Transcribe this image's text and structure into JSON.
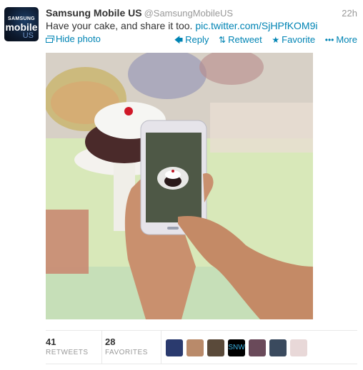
{
  "account": {
    "avatar_lines": [
      "SAMSUNG",
      "mobile",
      "US"
    ],
    "full_name": "Samsung Mobile US",
    "username": "@SamsungMobileUS",
    "timestamp": "22h"
  },
  "tweet": {
    "text": "Have your cake, and share it too.",
    "link": "pic.twitter.com/SjHPfKOM9i"
  },
  "actions": {
    "hide_photo": "Hide photo",
    "reply": "Reply",
    "retweet": "Retweet",
    "favorite": "Favorite",
    "more": "More",
    "link_color": "#0084b4"
  },
  "photo": {
    "description": "Hands holding a Samsung phone photographing a cupcake at a candy counter"
  },
  "stats": {
    "retweets_count": "41",
    "retweets_label": "RETWEETS",
    "favorites_count": "28",
    "favorites_label": "FAVORITES"
  },
  "favoriters": [
    {
      "name": "favoriter-1",
      "color": "#2a3a6e"
    },
    {
      "name": "favoriter-2",
      "color": "#b98a6a"
    },
    {
      "name": "favoriter-3",
      "color": "#5a4a3a"
    },
    {
      "name": "favoriter-4",
      "color": "#000000",
      "text": "SNW"
    },
    {
      "name": "favoriter-5",
      "color": "#6a4a5a"
    },
    {
      "name": "favoriter-6",
      "color": "#3a4a5e"
    },
    {
      "name": "favoriter-7",
      "color": "#e8d8d8"
    }
  ]
}
